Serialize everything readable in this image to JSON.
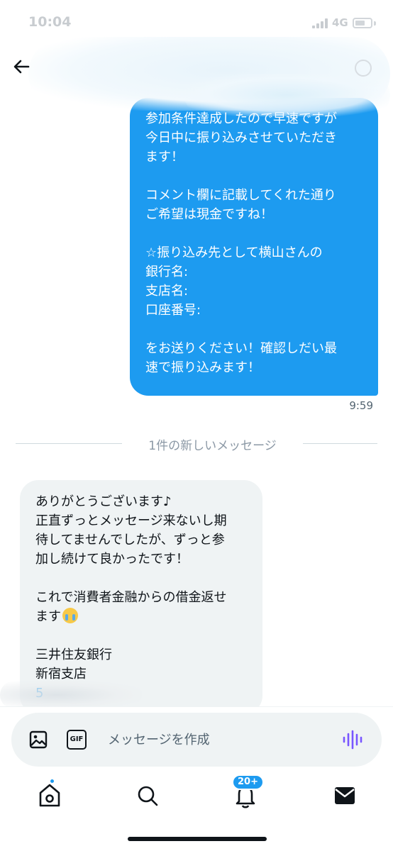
{
  "status_bar": {
    "time": "10:04",
    "network": "4G"
  },
  "header": {
    "back_icon": "arrow-left-icon",
    "info_icon": "info-icon"
  },
  "outgoing_message": {
    "lines": [
      "参加条件達成したので早速ですが",
      "今日中に振り込みさせていただき",
      "ます！",
      "",
      "コメント欄に記載してくれた通り",
      "ご希望は現金ですね！",
      "",
      "☆振り込み先として横山さんの",
      "銀行名:",
      "支店名:",
      "口座番号:",
      "",
      "をお送りください！確認しだい最",
      "速で振り込みます！"
    ],
    "time": "9:59"
  },
  "divider": {
    "label": "1件の新しいメッセージ"
  },
  "incoming_message": {
    "lines": [
      "ありがとうございます♪",
      "正直ずっとメッセージ来ないし期",
      "待してませんでしたが、ずっと参",
      "加し続けて良かったです！",
      "",
      "これで消費者金融からの借金返せ",
      "ます"
    ],
    "emoji": "loudly-crying-face-icon",
    "bank_name": "三井住友銀行",
    "branch_name": "新宿支店",
    "account_partial": "5"
  },
  "composer": {
    "placeholder": "メッセージを作成",
    "image_icon": "image-icon",
    "gif_label": "GIF",
    "voice_icon": "voice-wave-icon"
  },
  "tabbar": {
    "home_icon": "home-icon",
    "search_icon": "search-icon",
    "notifications_icon": "bell-icon",
    "notifications_badge": "20+",
    "messages_icon": "envelope-icon"
  },
  "colors": {
    "accent": "#1d9bf0",
    "incoming_bubble": "#eff3f4",
    "voice_icon": "#7856ff"
  }
}
